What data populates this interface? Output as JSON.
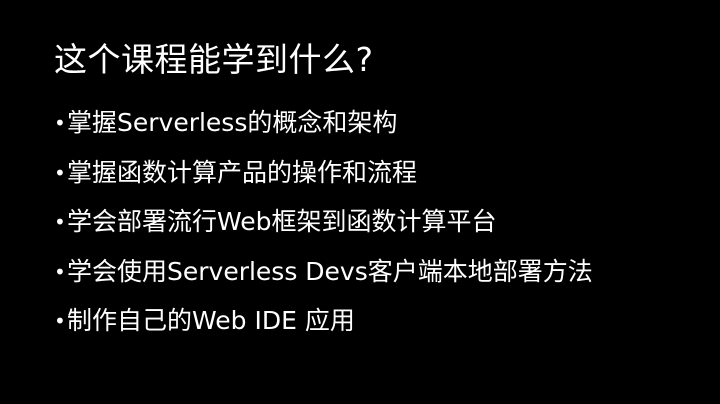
{
  "slide": {
    "title": "这个课程能学到什么?",
    "bullets": [
      "掌握Serverless的概念和架构",
      "掌握函数计算产品的操作和流程",
      "学会部署流行Web框架到函数计算平台",
      "学会使用Serverless Devs客户端本地部署方法",
      "制作自己的Web IDE 应用"
    ],
    "bullet_symbol": "•"
  },
  "colors": {
    "background": "#000000",
    "text": "#ffffff"
  }
}
